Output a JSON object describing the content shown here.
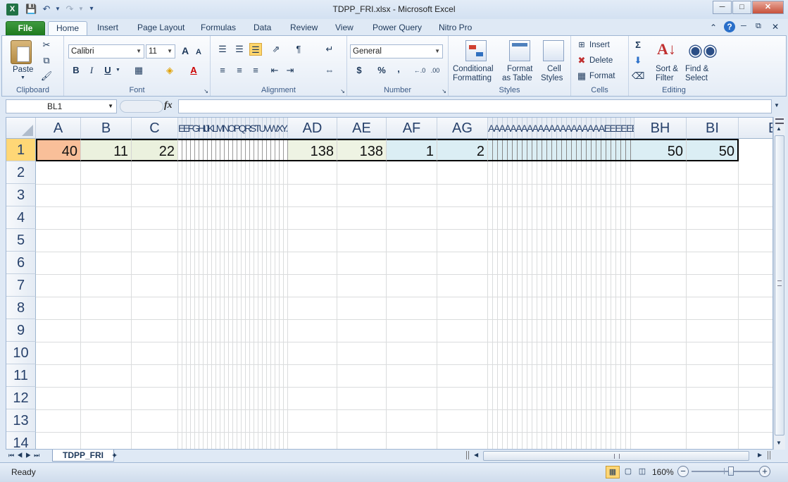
{
  "window": {
    "title": "TDPP_FRI.xlsx - Microsoft Excel"
  },
  "tabs": [
    {
      "label": "File"
    },
    {
      "label": "Home"
    },
    {
      "label": "Insert"
    },
    {
      "label": "Page Layout"
    },
    {
      "label": "Formulas"
    },
    {
      "label": "Data"
    },
    {
      "label": "Review"
    },
    {
      "label": "View"
    },
    {
      "label": "Power Query"
    },
    {
      "label": "Nitro Pro"
    }
  ],
  "ribbon": {
    "clipboard": {
      "label": "Clipboard",
      "paste": "Paste"
    },
    "font": {
      "label": "Font",
      "name": "Calibri",
      "size": "11",
      "bold": "B",
      "italic": "I",
      "underline": "U",
      "grow": "A",
      "shrink": "A"
    },
    "alignment": {
      "label": "Alignment"
    },
    "number": {
      "label": "Number",
      "format": "General",
      "currency": "$",
      "percent": "%",
      "comma": ","
    },
    "styles": {
      "label": "Styles",
      "conditional_1": "Conditional",
      "conditional_2": "Formatting",
      "table_1": "Format",
      "table_2": "as Table",
      "cell_1": "Cell",
      "cell_2": "Styles"
    },
    "cells": {
      "label": "Cells",
      "insert": "Insert",
      "delete": "Delete",
      "format": "Format"
    },
    "editing": {
      "label": "Editing",
      "sum": "Σ",
      "sort_1": "Sort &",
      "sort_2": "Filter",
      "find_1": "Find &",
      "find_2": "Select"
    }
  },
  "formula_bar": {
    "name_box": "BL1",
    "fx": "fx",
    "value": ""
  },
  "columns": {
    "A": "A",
    "B": "B",
    "C": "C",
    "squeezed_1": "EEFGHIJKLMNOPQRSTUVWXYZAA",
    "AD": "AD",
    "AE": "AE",
    "AF": "AF",
    "AG": "AG",
    "squeezed_2": "AAAAAAAAAAAAAAAAAAAAAEEEEEEE",
    "BH": "BH",
    "BI": "BI",
    "next": "B"
  },
  "rows": [
    "1",
    "2",
    "3",
    "4",
    "5",
    "6",
    "7",
    "8",
    "9",
    "10",
    "11",
    "12",
    "13",
    "14"
  ],
  "cells": {
    "A1": "40",
    "B1": "11",
    "C1": "22",
    "AD1": "138",
    "AE1": "138",
    "AF1": "1",
    "AG1": "2",
    "BH1": "50",
    "BI1": "50"
  },
  "sheet_tabs": [
    {
      "label": "TDPP_FRI"
    }
  ],
  "status": {
    "ready": "Ready",
    "zoom": "160%"
  },
  "colors": {
    "A1": "#f9bf99",
    "BC": "#ebf1de",
    "ADAE": "#eef3e3",
    "AFBI": "#dbeef4"
  }
}
